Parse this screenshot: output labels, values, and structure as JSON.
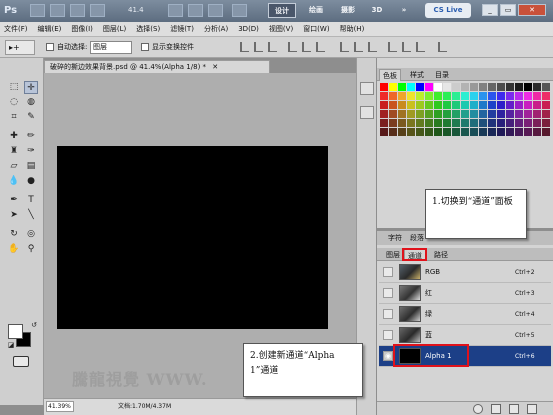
{
  "titlebar": {
    "logo": "Ps",
    "zoom": "41.4",
    "workspaces": [
      "设计",
      "绘画",
      "摄影",
      "3D",
      "»"
    ],
    "cs_live": "CS Live",
    "window_buttons": [
      "_",
      "▭",
      "✕"
    ]
  },
  "menu": [
    "文件(F)",
    "编辑(E)",
    "图像(I)",
    "图层(L)",
    "选择(S)",
    "滤镜(T)",
    "分析(A)",
    "3D(D)",
    "视图(V)",
    "窗口(W)",
    "帮助(H)"
  ],
  "options": {
    "tool_glyph": "▸+",
    "auto_select_label": "自动选择:",
    "auto_select_value": "图层",
    "show_transform_label": "显示变换控件"
  },
  "document": {
    "tab_title": "破碎的撕边效果背景.psd @ 41.4%(Alpha 1/8) *",
    "tab_close": "✕",
    "zoom_status": "41.39%",
    "doc_size": "文档:1.70M/4.37M",
    "watermark": "騰龍視覺 WWW."
  },
  "color_panel": {
    "tabs": [
      "色板",
      "样式",
      "目录"
    ],
    "active_tab": 0
  },
  "adjust_tabs": [
    "字符",
    "段落"
  ],
  "channels_panel": {
    "tabs": [
      "图层",
      "通道",
      "路径"
    ],
    "active_tab": 1,
    "channels": [
      {
        "name": "RGB",
        "shortcut": "Ctrl+2"
      },
      {
        "name": "红",
        "shortcut": "Ctrl+3"
      },
      {
        "name": "绿",
        "shortcut": "Ctrl+4"
      },
      {
        "name": "蓝",
        "shortcut": "Ctrl+5"
      },
      {
        "name": "Alpha 1",
        "shortcut": "Ctrl+6",
        "selected": true
      }
    ]
  },
  "callouts": {
    "step1": "1.切换到“通道”面板",
    "step2": "2.创建新通道“Alpha 1”通道"
  },
  "colors": {
    "highlight": "#e0121b",
    "selection": "#1c3f87",
    "canvas": "#000000"
  }
}
